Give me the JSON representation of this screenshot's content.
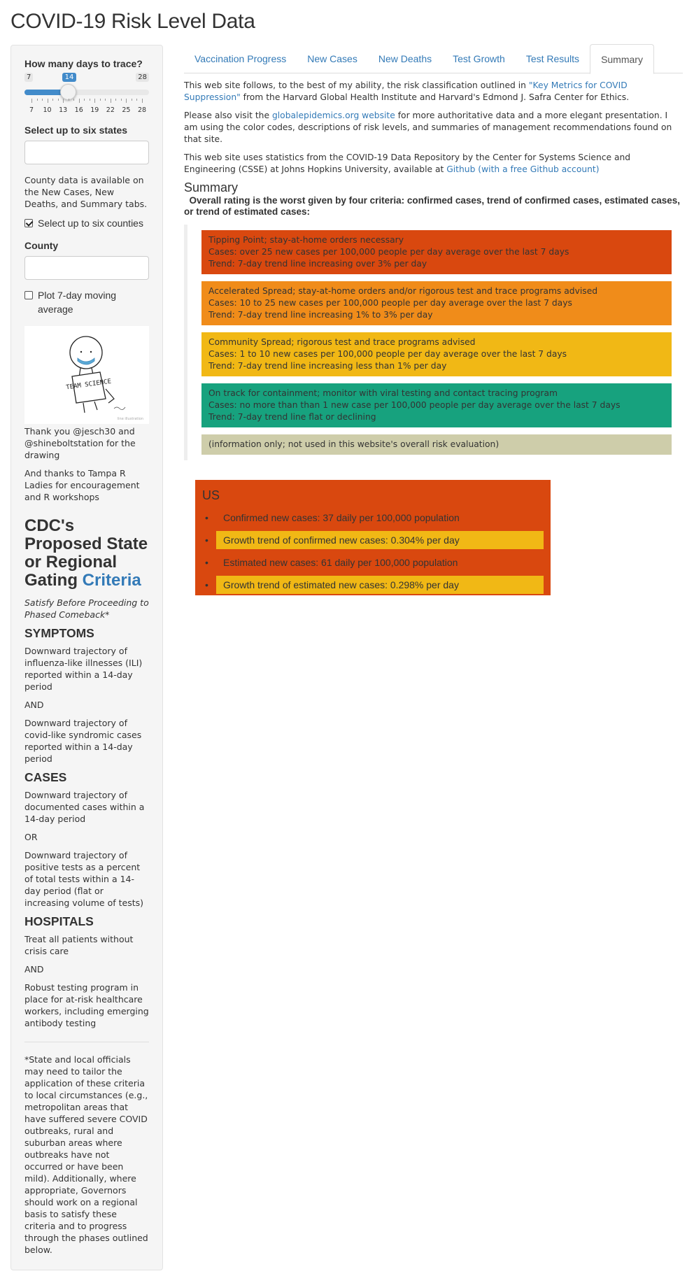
{
  "app_title": "COVID-19 Risk Level Data",
  "sidebar": {
    "days_label": "How many days to trace?",
    "slider": {
      "min": 7,
      "max": 28,
      "value": 14,
      "ticks": [
        "7",
        "10",
        "13",
        "16",
        "19",
        "22",
        "25",
        "28"
      ]
    },
    "states_label": "Select up to six states",
    "county_note": "County data is available on the New Cases, New Deaths, and Summary tabs.",
    "counties_checkbox_label": "Select up to six counties",
    "counties_checked": true,
    "county_label": "County",
    "moving_avg_label": "Plot 7-day moving average",
    "moving_avg_checked": false,
    "drawing_text": "TEAM SCIENCE",
    "drawing_credit": "line illustration",
    "thanks_drawing": "Thank you @jesch30 and @shineboltstation for the drawing",
    "thanks_ladies": "And thanks to Tampa R Ladies for encouragement and R workshops",
    "cdc_title": "CDC's Proposed State or Regional Gating",
    "cdc_link": "Criteria",
    "cdc_subtitle": "Satisfy Before Proceeding to Phased Comeback*",
    "sections": [
      {
        "heading": "SYMPTOMS",
        "items": [
          "Downward trajectory of influenza-like illnesses (ILI) reported within a 14-day period",
          "AND",
          "Downward trajectory of covid-like syndromic cases reported within a 14-day period"
        ]
      },
      {
        "heading": "CASES",
        "items": [
          "Downward trajectory of documented cases within a 14-day period",
          "OR",
          "Downward trajectory of positive tests as a percent of total tests within a 14-day period (flat or increasing volume of tests)"
        ]
      },
      {
        "heading": "HOSPITALS",
        "items": [
          "Treat all patients without crisis care",
          "AND",
          "Robust testing program in place for at-risk healthcare workers, including emerging antibody testing"
        ]
      }
    ],
    "footnote": "*State and local officials may need to tailor the application of these criteria to local circumstances (e.g., metropolitan areas that have suffered severe COVID outbreaks, rural and suburban areas where outbreaks have not occurred or have been mild). Additionally, where appropriate, Governors should work on a regional basis to satisfy these criteria and to progress through the phases outlined below."
  },
  "tabs": [
    {
      "label": "Vaccination Progress",
      "active": false
    },
    {
      "label": "New Cases",
      "active": false
    },
    {
      "label": "New Deaths",
      "active": false
    },
    {
      "label": "Test Growth",
      "active": false
    },
    {
      "label": "Test Results",
      "active": false
    },
    {
      "label": "Summary",
      "active": true
    }
  ],
  "main": {
    "intro1_pre": "This web site follows, to the best of my ability, the risk classification outlined in ",
    "intro1_link": "\"Key Metrics for COVID Suppression\"",
    "intro1_post": " from the Harvard Global Health Institute and Harvard's Edmond J. Safra Center for Ethics.",
    "intro2_pre": "Please also visit the ",
    "intro2_link": "globalepidemics.org website",
    "intro2_post": " for more authoritative data and a more elegant presentation. I am using the color codes, descriptions of risk levels, and summaries of management recommendations found on that site.",
    "intro3_pre": "This web site uses statistics from the COVID-19 Data Repository by the Center for Systems Science and Engineering (CSSE) at Johns Hopkins University, available at ",
    "intro3_link": "Github (with a free Github account)",
    "summary_title": "Summary",
    "overall_text": "Overall rating is the worst given by four criteria: confirmed cases, trend of confirmed cases, estimated cases, or trend of estimated cases:",
    "levels": [
      {
        "color": "#d9480f",
        "lines": [
          "Tipping Point; stay-at-home orders necessary",
          "Cases: over 25 new cases per 100,000 people per day average over the last 7 days",
          "Trend: 7-day trend line increasing over 3% per day"
        ]
      },
      {
        "color": "#f08c1a",
        "lines": [
          "Accelerated Spread; stay-at-home orders and/or rigorous test and trace programs advised",
          "Cases: 10 to 25 new cases per 100,000 people per day average over the last 7 days",
          "Trend: 7-day trend line increasing 1% to 3% per day"
        ]
      },
      {
        "color": "#f1b815",
        "lines": [
          "Community Spread; rigorous test and trace programs advised",
          "Cases: 1 to 10 new cases per 100,000 people per day average over the last 7 days",
          "Trend: 7-day trend line increasing less than 1% per day"
        ]
      },
      {
        "color": "#17a27e",
        "lines": [
          "On track for containment; monitor with viral testing and contact tracing program",
          "Cases: no more than than 1 new case per 100,000 people per day average over the last 7 days",
          "Trend: 7-day trend line flat or declining"
        ]
      },
      {
        "color": "#cecdaa",
        "lines": [
          "(information only; not used in this website's overall risk evaluation)"
        ]
      }
    ],
    "us_box": {
      "title": "US",
      "color": "#d9480f",
      "items": [
        {
          "text": "Confirmed new cases: 37 daily per 100,000 population",
          "color": "#d9480f"
        },
        {
          "text": "Growth trend of confirmed new cases: 0.304% per day",
          "color": "#f1b815"
        },
        {
          "text": "Estimated new cases: 61 daily per 100,000 population",
          "color": "#d9480f"
        },
        {
          "text": "Growth trend of estimated new cases: 0.298% per day",
          "color": "#f1b815"
        }
      ]
    }
  }
}
